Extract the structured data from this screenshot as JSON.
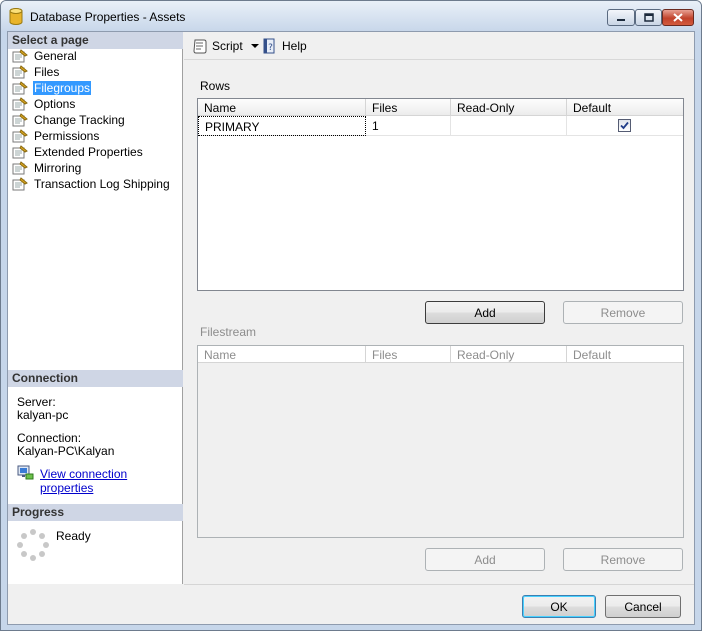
{
  "window": {
    "title": "Database Properties - Assets"
  },
  "sidebar": {
    "select_header": "Select a page",
    "items": [
      {
        "label": "General"
      },
      {
        "label": "Files"
      },
      {
        "label": "Filegroups",
        "selected": true
      },
      {
        "label": "Options"
      },
      {
        "label": "Change Tracking"
      },
      {
        "label": "Permissions"
      },
      {
        "label": "Extended Properties"
      },
      {
        "label": "Mirroring"
      },
      {
        "label": "Transaction Log Shipping"
      }
    ],
    "connection_header": "Connection",
    "server_label": "Server:",
    "server_value": "kalyan-pc",
    "connection_label": "Connection:",
    "connection_value": "Kalyan-PC\\Kalyan",
    "view_link": "View connection properties",
    "progress_header": "Progress",
    "progress_status": "Ready"
  },
  "toolbar": {
    "script_label": "Script",
    "help_label": "Help"
  },
  "rows_group": {
    "label": "Rows",
    "columns": [
      "Name",
      "Files",
      "Read-Only",
      "Default"
    ],
    "rows": [
      {
        "name": "PRIMARY",
        "files": "1",
        "read_only": "",
        "default": true
      }
    ],
    "add_label": "Add",
    "remove_label": "Remove"
  },
  "filestream_group": {
    "label": "Filestream",
    "columns": [
      "Name",
      "Files",
      "Read-Only",
      "Default"
    ],
    "add_label": "Add",
    "remove_label": "Remove"
  },
  "footer": {
    "ok_label": "OK",
    "cancel_label": "Cancel"
  },
  "colors": {
    "selection": "#3399ff",
    "section_header": "#cfd6e5",
    "link": "#0000cc"
  }
}
